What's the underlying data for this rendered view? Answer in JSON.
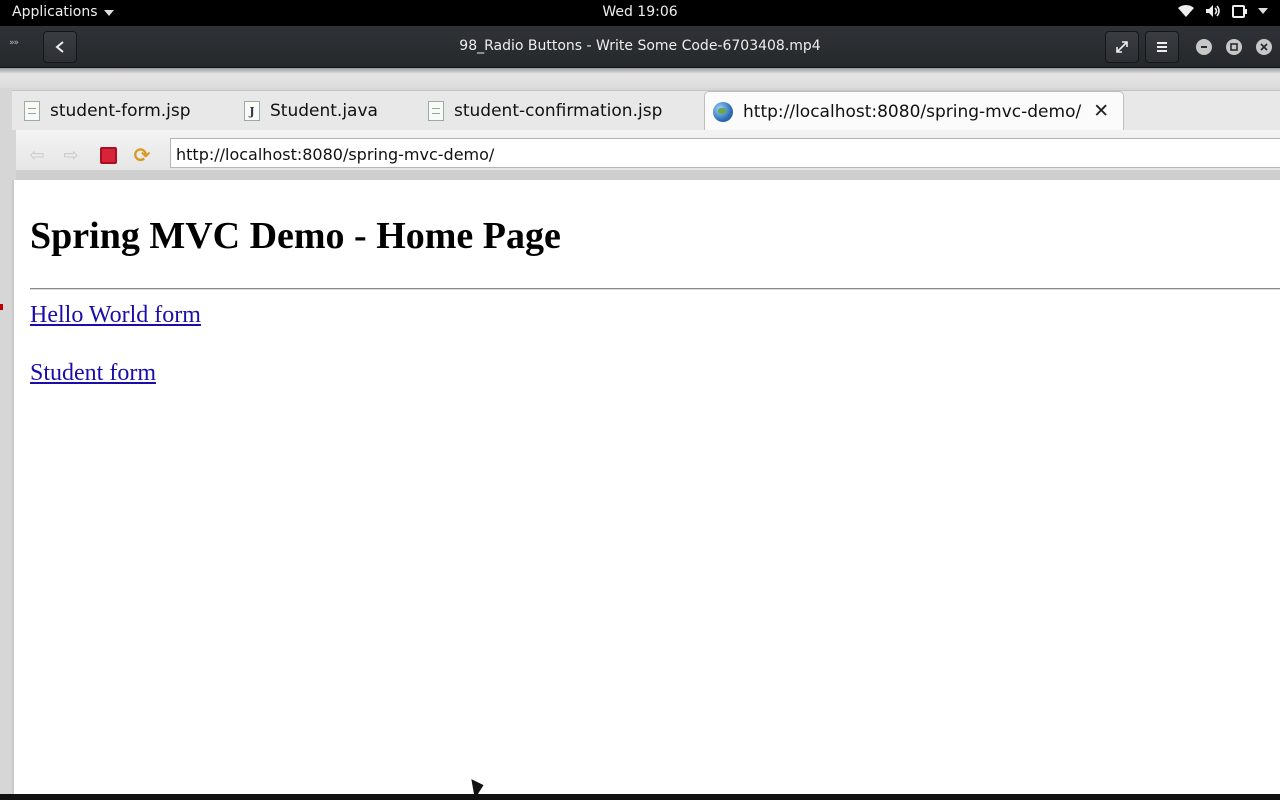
{
  "system_bar": {
    "applications_label": "Applications",
    "clock": "Wed 19:06",
    "tray_icons": [
      "wifi-icon",
      "volume-icon",
      "power-icon"
    ]
  },
  "player": {
    "title": "98_Radio Buttons - Write Some Code-6703408.mp4",
    "buttons": [
      "back-icon",
      "fullscreen-icon",
      "menu-icon",
      "minimize-icon",
      "maximize-icon",
      "close-icon"
    ]
  },
  "browser": {
    "tabs": [
      {
        "label": "student-form.jsp",
        "icon": "jsp-file-icon"
      },
      {
        "label": "Student.java",
        "icon": "java-file-icon"
      },
      {
        "label": "student-confirmation.jsp",
        "icon": "jsp-file-icon"
      },
      {
        "label": "http://localhost:8080/spring-mvc-demo/",
        "icon": "globe-icon",
        "active": true
      }
    ],
    "url": "http://localhost:8080/spring-mvc-demo/"
  },
  "page": {
    "heading": "Spring MVC Demo - Home Page",
    "links": [
      "Hello World form",
      "Student form"
    ]
  },
  "colors": {
    "link": "#1a0dab",
    "stop_button": "#d8243a",
    "player_bar": "#2f3337"
  }
}
